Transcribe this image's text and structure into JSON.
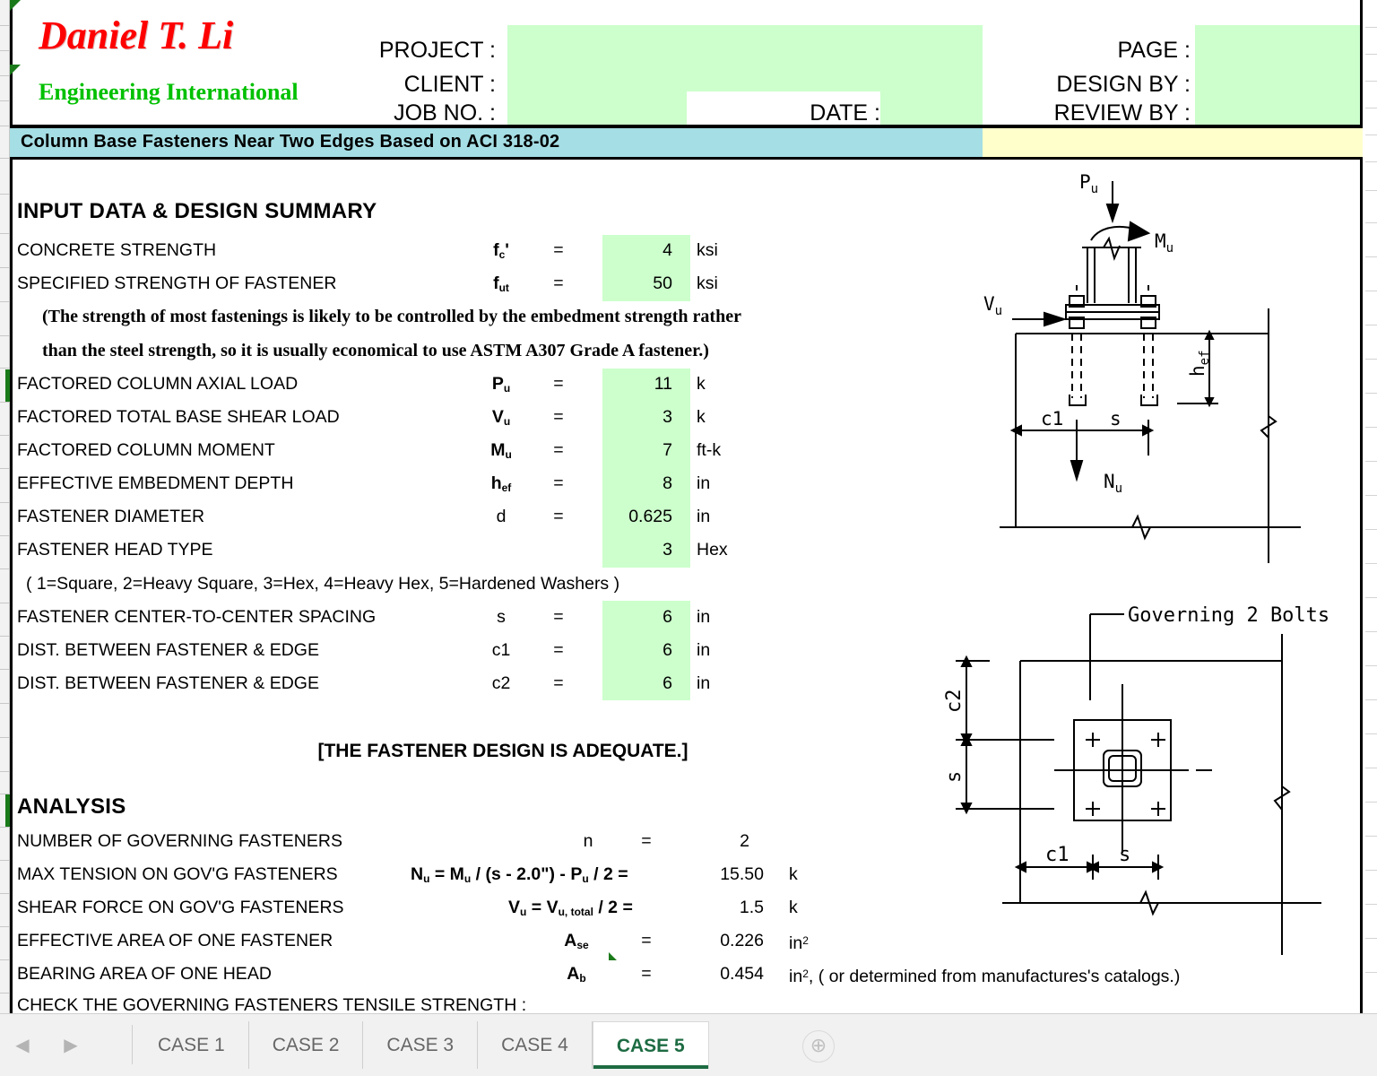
{
  "logo": {
    "line1": "Daniel T. Li",
    "line2": "Engineering International"
  },
  "header": {
    "project_label": "PROJECT :",
    "client_label": "CLIENT :",
    "job_no_label": "JOB NO. :",
    "date_label": "DATE :",
    "page_label": "PAGE :",
    "design_by_label": "DESIGN BY :",
    "review_by_label": "REVIEW BY :",
    "project_value": "",
    "client_value": "",
    "job_no_value": "",
    "date_value": "",
    "page_value": "",
    "design_by_value": "",
    "review_by_value": ""
  },
  "title": "Column Base Fasteners Near Two Edges Based on ACI 318-02",
  "colors": {
    "input_cell": "#CCFFCC",
    "title_teal": "#A5DEE4",
    "title_yellow": "#FFFFCC",
    "logo_red": "#FF0000",
    "logo_green": "#00C000",
    "active_tab": "#1D6B42"
  },
  "input_section": {
    "heading": "INPUT DATA & DESIGN SUMMARY",
    "note1": "(The strength of most fastenings is likely to be controlled by the embedment strength rather",
    "note2": "than the steel strength, so it is usually economical to use ASTM A307 Grade A fastener.)",
    "head_type_note": "( 1=Square, 2=Heavy Square, 3=Hex, 4=Heavy Hex, 5=Hardened Washers )",
    "verdict": "[THE FASTENER DESIGN IS ADEQUATE.]",
    "rows": [
      {
        "label": "CONCRETE STRENGTH",
        "sym": "f",
        "sub": "c",
        "prime": "'",
        "eq": "=",
        "value": "4",
        "unit": "ksi"
      },
      {
        "label": "SPECIFIED STRENGTH OF FASTENER",
        "sym": "f",
        "sub": "ut",
        "prime": "",
        "eq": "=",
        "value": "50",
        "unit": "ksi"
      },
      {
        "label": "FACTORED COLUMN AXIAL LOAD",
        "sym": "P",
        "sub": "u",
        "prime": "",
        "eq": "=",
        "value": "11",
        "unit": "k"
      },
      {
        "label": "FACTORED TOTAL BASE SHEAR LOAD",
        "sym": "V",
        "sub": "u",
        "prime": "",
        "eq": "=",
        "value": "3",
        "unit": "k"
      },
      {
        "label": "FACTORED COLUMN MOMENT",
        "sym": "M",
        "sub": "u",
        "prime": "",
        "eq": "=",
        "value": "7",
        "unit": "ft-k"
      },
      {
        "label": "EFFECTIVE EMBEDMENT DEPTH",
        "sym": "h",
        "sub": "ef",
        "prime": "",
        "eq": "=",
        "value": "8",
        "unit": "in"
      },
      {
        "label": "FASTENER DIAMETER",
        "sym": "d",
        "sub": "",
        "prime": "",
        "eq": "=",
        "value": "0.625",
        "unit": "in"
      },
      {
        "label": "FASTENER HEAD TYPE",
        "sym": "",
        "sub": "",
        "prime": "",
        "eq": "",
        "value": "3",
        "unit": "Hex"
      },
      {
        "label": "FASTENER CENTER-TO-CENTER SPACING",
        "sym": "s",
        "sub": "",
        "prime": "",
        "eq": "=",
        "value": "6",
        "unit": "in"
      },
      {
        "label": "DIST. BETWEEN FASTENER & EDGE",
        "sym": "c1",
        "sub": "",
        "prime": "",
        "eq": "=",
        "value": "6",
        "unit": "in"
      },
      {
        "label": "DIST. BETWEEN FASTENER & EDGE",
        "sym": "c2",
        "sub": "",
        "prime": "",
        "eq": "=",
        "value": "6",
        "unit": "in"
      }
    ]
  },
  "analysis_section": {
    "heading": "ANALYSIS",
    "row_n": {
      "label": "NUMBER OF GOVERNING FASTENERS",
      "formula_sym": "n",
      "eq": "=",
      "value": "2",
      "unit": ""
    },
    "row_nu": {
      "label": "MAX TENSION ON GOV'G FASTENERS",
      "value": "15.50",
      "unit": "k"
    },
    "row_vu": {
      "label": "SHEAR FORCE ON GOV'G FASTENERS",
      "value": "1.5",
      "unit": "k"
    },
    "row_ase": {
      "label": "EFFECTIVE AREA OF ONE FASTENER",
      "value": "0.226",
      "unit": "in"
    },
    "row_ab": {
      "label": "BEARING AREA OF ONE HEAD",
      "value": "0.454",
      "unit": "in",
      "trailing": ", ( or determined from manufactures's catalogs.)"
    },
    "row_check": {
      "label": "CHECK THE GOVERNING FASTENERS TENSILE STRENGTH :"
    }
  },
  "diagram_elevation": {
    "label_pu": "P",
    "label_pu_sub": "u",
    "label_mu": "M",
    "label_mu_sub": "u",
    "label_vu": "V",
    "label_vu_sub": "u",
    "label_nu": "N",
    "label_nu_sub": "u",
    "label_hef": "h",
    "label_hef_sub": "ef",
    "label_c1": "c1",
    "label_s": "s"
  },
  "diagram_plan": {
    "callout": "Governing 2 Bolts",
    "label_c1": "c1",
    "label_c2": "c2",
    "label_s_h": "s",
    "label_s_v": "s"
  },
  "tabs": {
    "items": [
      {
        "label": "CASE 1",
        "active": false
      },
      {
        "label": "CASE 2",
        "active": false
      },
      {
        "label": "CASE 3",
        "active": false
      },
      {
        "label": "CASE 4",
        "active": false
      },
      {
        "label": "CASE 5",
        "active": true
      }
    ],
    "prev_icon": "◀",
    "next_icon": "▶",
    "add_icon": "⊕"
  }
}
